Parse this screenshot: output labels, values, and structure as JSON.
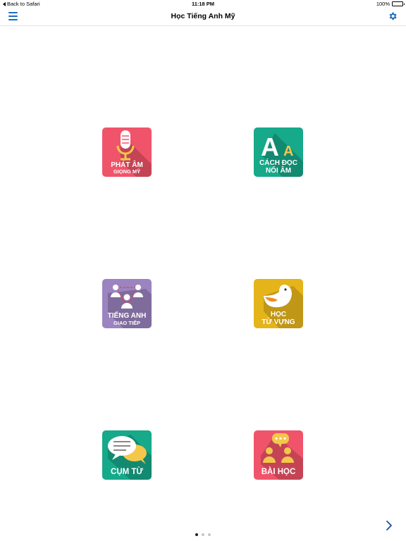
{
  "status_bar": {
    "back_label": "Back to Safari",
    "time": "11:18 PM",
    "battery": "100%"
  },
  "nav": {
    "title": "Học Tiếng Anh Mỹ",
    "menu_icon": "hamburger-menu-icon",
    "settings_icon": "gear-icon"
  },
  "tiles": [
    {
      "id": "phat-am",
      "line1": "PHÁT ÂM",
      "line2": "GIỌNG MỸ",
      "color": "#f0546a",
      "icon": "microphone-icon"
    },
    {
      "id": "cach-doc",
      "line1": "CÁCH ĐỌC",
      "line2": "NỐI ÂM",
      "color": "#16a98a",
      "icon": "letters-aa-icon"
    },
    {
      "id": "tieng-anh",
      "line1": "TIẾNG ANH",
      "line2": "GIAO TIẾP",
      "color": "#9b84c0",
      "icon": "people-group-icon"
    },
    {
      "id": "hoc-tu-vung",
      "line1": "HỌC",
      "line2": "TỪ VỰNG",
      "color": "#e5b41b",
      "icon": "bird-icon"
    },
    {
      "id": "cum-tu",
      "line1": "CỤM TỪ",
      "color": "#16a98a",
      "icon": "chat-bubbles-icon"
    },
    {
      "id": "bai-hoc",
      "line1": "BÀI HỌC",
      "color": "#f0546a",
      "icon": "conversation-people-icon"
    }
  ],
  "pager": {
    "pages": 3,
    "current": 1,
    "next_icon": "chevron-right-icon"
  }
}
